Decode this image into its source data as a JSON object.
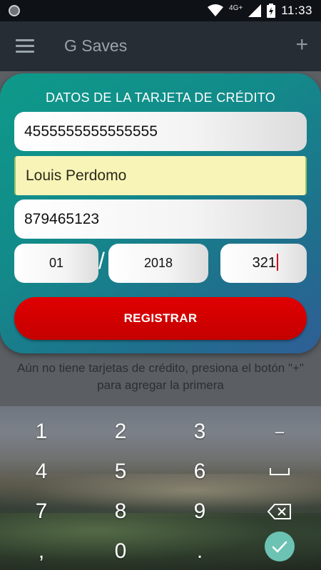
{
  "status_bar": {
    "network": "4G+",
    "time": "11:33"
  },
  "app_bar": {
    "title": "G Saves",
    "add_label": "+"
  },
  "dialog": {
    "title": "DATOS DE LA TARJETA DE CRÉDITO",
    "card_number": "4555555555555555",
    "holder_name": "Louis Perdomo",
    "id_number": "879465123",
    "exp_month": "01",
    "separator": "/",
    "exp_year": "2018",
    "cvv": "321",
    "register_label": "REGISTRAR"
  },
  "empty_message": "Aún no tiene tarjetas de crédito, presiona el botón \"+\" para agregar la primera",
  "keyboard": {
    "keys": [
      "1",
      "2",
      "3",
      "–",
      "4",
      "5",
      "6",
      "7",
      "8",
      "9",
      ",",
      "0",
      "."
    ],
    "icons": [
      "space-icon",
      "backspace-icon",
      "check-icon"
    ],
    "accent": "#6cc3b3"
  }
}
